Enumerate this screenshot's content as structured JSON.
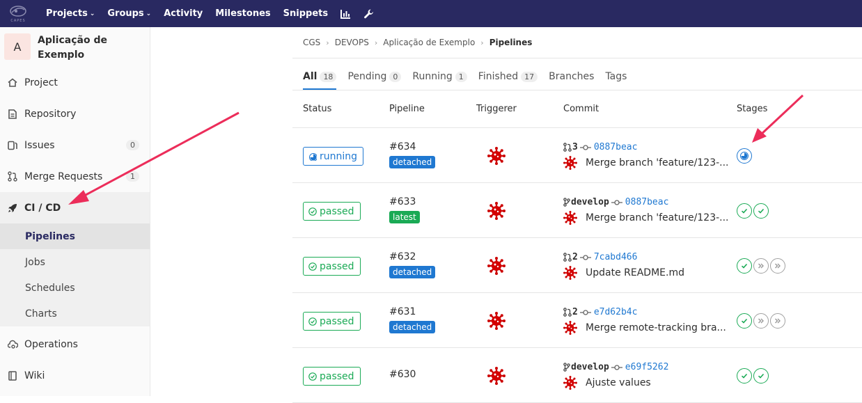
{
  "app": {
    "logo_text": "CAPES",
    "nav": [
      {
        "label": "Projects",
        "caret": true
      },
      {
        "label": "Groups",
        "caret": true
      },
      {
        "label": "Activity",
        "caret": false
      },
      {
        "label": "Milestones",
        "caret": false
      },
      {
        "label": "Snippets",
        "caret": false
      }
    ]
  },
  "sidebar": {
    "avatar_letter": "A",
    "project_name": "Aplicação de Exemplo",
    "items": [
      {
        "label": "Project",
        "icon": "home-icon"
      },
      {
        "label": "Repository",
        "icon": "document-icon"
      },
      {
        "label": "Issues",
        "icon": "issues-icon",
        "count": "0"
      },
      {
        "label": "Merge Requests",
        "icon": "merge-request-icon",
        "count": "1"
      },
      {
        "label": "CI / CD",
        "icon": "rocket-icon"
      },
      {
        "label": "Operations",
        "icon": "cloud-gear-icon"
      },
      {
        "label": "Wiki",
        "icon": "book-icon"
      }
    ],
    "cicd_sub": [
      "Pipelines",
      "Jobs",
      "Schedules",
      "Charts"
    ]
  },
  "breadcrumb": [
    "CGS",
    "DEVOPS",
    "Aplicação de Exemplo",
    "Pipelines"
  ],
  "tabs": [
    {
      "label": "All",
      "count": "18"
    },
    {
      "label": "Pending",
      "count": "0"
    },
    {
      "label": "Running",
      "count": "1"
    },
    {
      "label": "Finished",
      "count": "17"
    },
    {
      "label": "Branches",
      "count": null
    },
    {
      "label": "Tags",
      "count": null
    }
  ],
  "table": {
    "headers": {
      "status": "Status",
      "pipeline": "Pipeline",
      "triggerer": "Triggerer",
      "commit": "Commit",
      "stages": "Stages"
    },
    "rows": [
      {
        "status": "running",
        "id": "#634",
        "tag": "detached",
        "ref_icon": "merge-request",
        "ref": "3",
        "sha": "0887beac",
        "message": "Merge branch 'feature/123-...",
        "stages": [
          "running"
        ]
      },
      {
        "status": "passed",
        "id": "#633",
        "tag": "latest",
        "ref_icon": "branch",
        "ref": "develop",
        "sha": "0887beac",
        "message": "Merge branch 'feature/123-...",
        "stages": [
          "success",
          "success"
        ]
      },
      {
        "status": "passed",
        "id": "#632",
        "tag": "detached",
        "ref_icon": "merge-request",
        "ref": "2",
        "sha": "7cabd466",
        "message": "Update README.md",
        "stages": [
          "success",
          "skipped",
          "skipped"
        ]
      },
      {
        "status": "passed",
        "id": "#631",
        "tag": "detached",
        "ref_icon": "merge-request",
        "ref": "2",
        "sha": "e7d62b4c",
        "message": "Merge remote-tracking bra...",
        "stages": [
          "success",
          "skipped",
          "skipped"
        ]
      },
      {
        "status": "passed",
        "id": "#630",
        "tag": null,
        "ref_icon": "branch",
        "ref": "develop",
        "sha": "e69f5262",
        "message": "Ajuste values",
        "stages": [
          "success",
          "success"
        ]
      }
    ]
  },
  "colors": {
    "nav_bg": "#292961",
    "link": "#1f78d1",
    "success": "#1aaa55",
    "arrow": "#ec2d5a"
  }
}
